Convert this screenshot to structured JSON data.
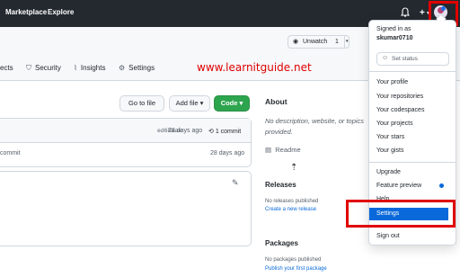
{
  "topbar": {
    "nav": [
      "Marketplace",
      "Explore"
    ],
    "plus": "+",
    "caret": "▾"
  },
  "repo_header": {
    "watch": {
      "icon": "◉",
      "label": "Unwatch",
      "count": "1",
      "caret": "▾"
    },
    "tabs": [
      {
        "icon": "",
        "label": "ects"
      },
      {
        "icon": "⛉",
        "label": "Security"
      },
      {
        "icon": "⌇",
        "label": "Insights"
      },
      {
        "icon": "⚙",
        "label": "Settings"
      }
    ]
  },
  "watermark": "www.learnitguide.net",
  "toolbar": {
    "goto_file": "Go to file",
    "add_file": "Add file ▾",
    "code": "Code ▾"
  },
  "latest_commit": {
    "sha": "ed68aae",
    "ago": "28 days ago",
    "history_icon": "⟲",
    "commits": "1 commit"
  },
  "file_row": {
    "message": "commit",
    "ago": "28 days ago"
  },
  "readme_box": {
    "edit_icon": "✎"
  },
  "about": {
    "title": "About",
    "description": "No description, website, or topics provided.",
    "readme_icon": "▤",
    "readme": "Readme",
    "cursor": "⇡"
  },
  "releases": {
    "title": "Releases",
    "empty": "No releases published",
    "create": "Create a new release"
  },
  "packages": {
    "title": "Packages",
    "empty": "No packages published",
    "publish": "Publish your first package"
  },
  "dropdown": {
    "signed_in_as": "Signed in as",
    "username": "skumar0710",
    "set_status": "Set status",
    "status_icon": "☺",
    "group1": [
      "Your profile",
      "Your repositories",
      "Your codespaces",
      "Your projects",
      "Your stars",
      "Your gists"
    ],
    "upgrade": "Upgrade",
    "feature_preview": "Feature preview",
    "help": "Help",
    "settings": "Settings",
    "sign_out": "Sign out"
  },
  "colors": {
    "highlight": "#e00000",
    "accent": "#0969da",
    "code_green": "#2da44e",
    "topbar": "#24292f"
  },
  "icons": [
    "bell-icon",
    "plus-icon",
    "avatar",
    "eye-icon",
    "shield-icon",
    "graph-icon",
    "gear-icon",
    "history-icon",
    "pencil-icon",
    "book-icon",
    "smiley-icon",
    "cursor-icon"
  ]
}
